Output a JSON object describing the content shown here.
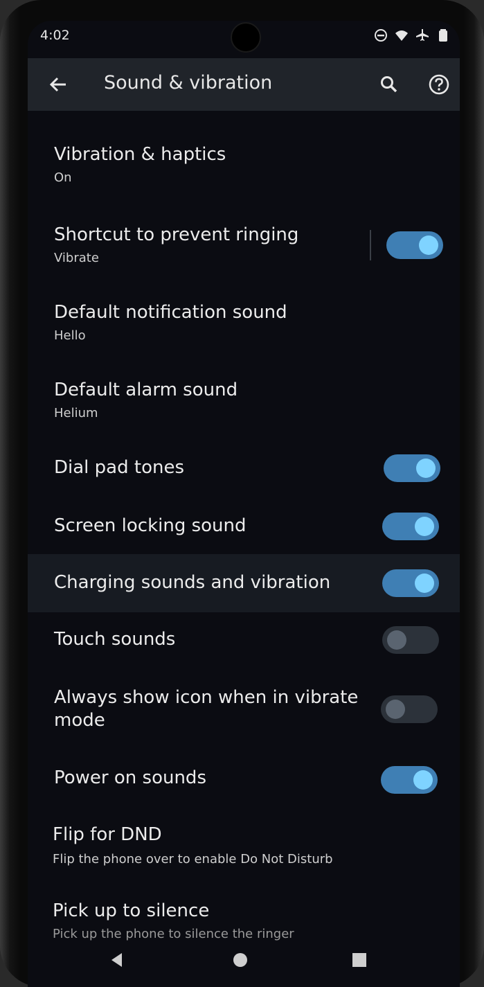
{
  "status_bar": {
    "time": "4:02",
    "icons": [
      "dnd-icon",
      "wifi-icon",
      "airplane-icon",
      "battery-icon"
    ]
  },
  "app_bar": {
    "title": "Sound & vibration",
    "back_icon": "back-arrow-icon",
    "search_icon": "search-icon",
    "help_icon": "help-icon"
  },
  "settings": [
    {
      "title": "Vibration & haptics",
      "subtitle": "On"
    },
    {
      "title": "Shortcut to prevent ringing",
      "subtitle": "Vibrate",
      "toggle": true
    },
    {
      "title": "Default notification sound",
      "subtitle": "Hello"
    },
    {
      "title": "Default alarm sound",
      "subtitle": "Helium"
    },
    {
      "title": "Dial pad tones",
      "toggle": true
    },
    {
      "title": "Screen locking sound",
      "toggle": true
    },
    {
      "title": "Charging sounds and vibration",
      "toggle": true
    },
    {
      "title": "Touch sounds",
      "toggle": false
    },
    {
      "title": "Always show icon when in vibrate mode",
      "title_line1": "Always show icon when in vibrate",
      "title_line2": "mode",
      "toggle": false
    },
    {
      "title": "Power on sounds",
      "toggle": true
    },
    {
      "title": "Flip for DND",
      "subtitle": "Flip the phone over to enable Do Not Disturb"
    },
    {
      "title": "Pick up to silence",
      "subtitle": "Pick up the phone to silence the ringer"
    }
  ],
  "nav_bar": {
    "back_icon": "nav-back-icon",
    "home_icon": "nav-home-icon",
    "recents_icon": "nav-recents-icon"
  },
  "colors": {
    "toggle_on": "#3f7fb4",
    "knob_on": "#7fd3ff",
    "toggle_off": "#2c323a",
    "background": "#0b0c12",
    "app_bar": "#20242a"
  }
}
